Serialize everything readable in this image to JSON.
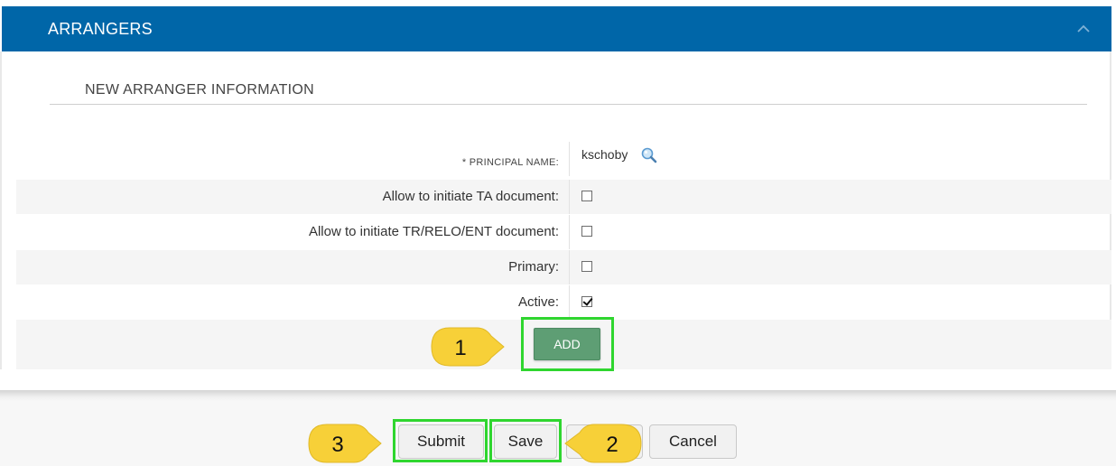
{
  "panel": {
    "title": "ARRANGERS",
    "section_title": "NEW ARRANGER INFORMATION"
  },
  "form": {
    "principal_label": "* PRINCIPAL NAME:",
    "principal_value": "kschoby",
    "rows": [
      {
        "label": "Allow to initiate TA document:",
        "checked": false
      },
      {
        "label": "Allow to initiate TR/RELO/ENT document:",
        "checked": false
      },
      {
        "label": "Primary:",
        "checked": false
      },
      {
        "label": "Active:",
        "checked": true
      }
    ],
    "add_label": "ADD"
  },
  "footer": {
    "submit_label": "Submit",
    "save_label": "Save",
    "cancel_label": "Cancel"
  },
  "callouts": {
    "one": "1",
    "two": "2",
    "three": "3"
  },
  "colors": {
    "header_bg": "#0066a8",
    "add_button": "#5e9e74",
    "highlight": "#2fd62f",
    "callout": "#f7d038"
  },
  "icons": {
    "collapse": "chevron-up-icon",
    "lookup": "magnifier-icon"
  }
}
